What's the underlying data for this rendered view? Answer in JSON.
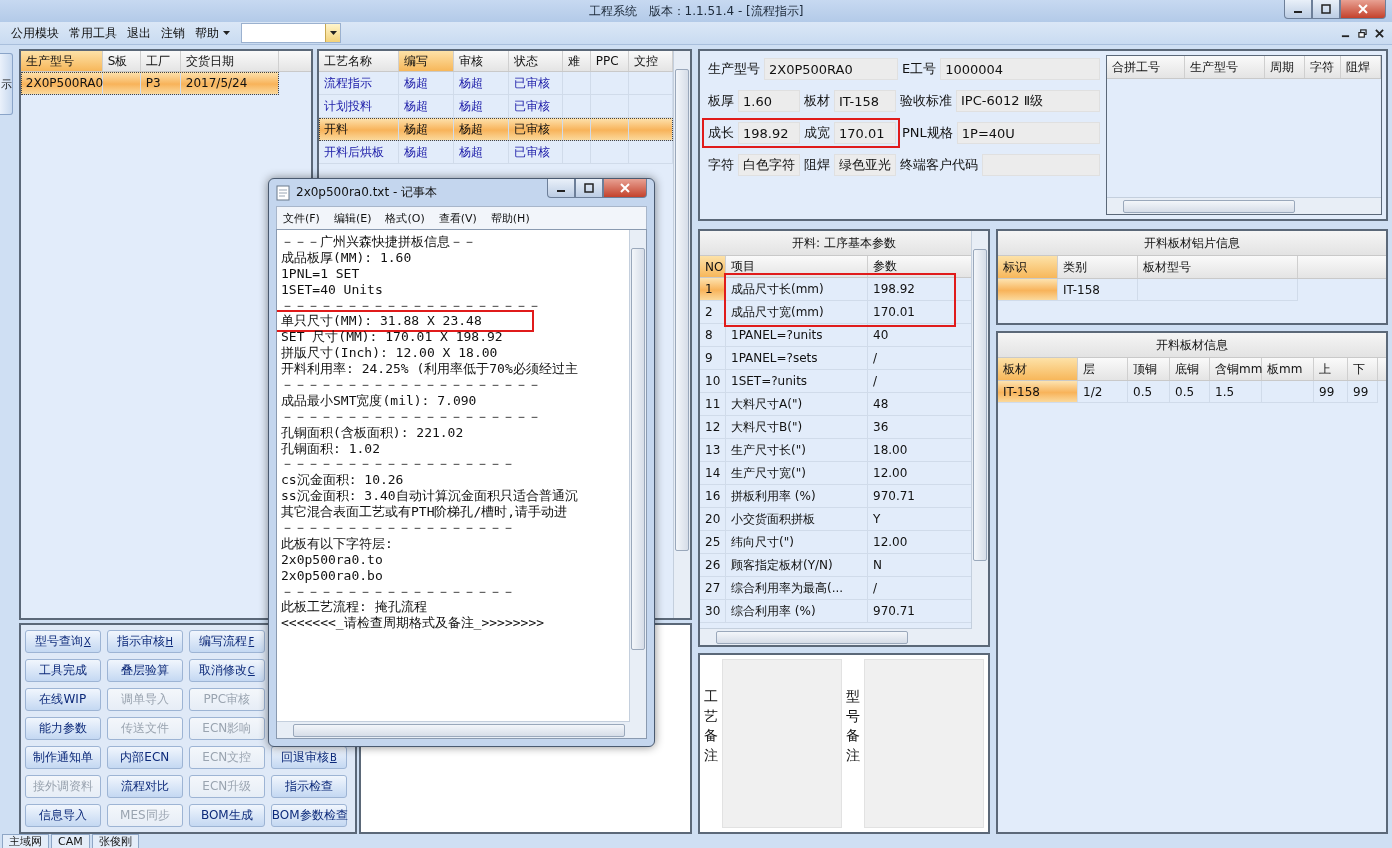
{
  "window": {
    "title": "工程系统　版本：1.1.51.4 - [流程指示]"
  },
  "menu": {
    "items": [
      {
        "label": "公用模块",
        "kind": "item"
      },
      {
        "label": "常用工具",
        "kind": "item"
      },
      {
        "label": "退出",
        "kind": "item"
      },
      {
        "label": "注销",
        "kind": "item"
      },
      {
        "label": "帮助",
        "kind": "dropdown"
      }
    ]
  },
  "edge_tab": {
    "label": "示"
  },
  "orders": {
    "columns": [
      {
        "label": "生产型号",
        "sorted": true
      },
      {
        "label": "S板",
        "sorted": false
      },
      {
        "label": "工厂",
        "sorted": false
      },
      {
        "label": "交货日期",
        "sorted": false
      }
    ],
    "rows": [
      {
        "cells": [
          "2X0P500RA0",
          "",
          "P3",
          "2017/5/24"
        ],
        "selected": true
      }
    ]
  },
  "process": {
    "columns": [
      {
        "label": "工艺名称",
        "sorted": false
      },
      {
        "label": "编写",
        "sorted": true
      },
      {
        "label": "审核",
        "sorted": false
      },
      {
        "label": "状态",
        "sorted": false
      },
      {
        "label": "难",
        "sorted": false
      },
      {
        "label": "PPC",
        "sorted": false
      },
      {
        "label": "文控",
        "sorted": false
      }
    ],
    "rows": [
      {
        "cells": [
          "流程指示",
          "杨超",
          "杨超",
          "已审核",
          "",
          "",
          ""
        ],
        "selected": false
      },
      {
        "cells": [
          "计划投料",
          "杨超",
          "杨超",
          "已审核",
          "",
          "",
          ""
        ],
        "selected": false
      },
      {
        "cells": [
          "开料",
          "杨超",
          "杨超",
          "已审核",
          "",
          "",
          ""
        ],
        "selected": true
      },
      {
        "cells": [
          "开料后烘板",
          "杨超",
          "杨超",
          "已审核",
          "",
          "",
          ""
        ],
        "selected": false
      }
    ]
  },
  "button_rows": [
    [
      {
        "label": "型号查询",
        "hotkey": "X",
        "disabled": false
      },
      {
        "label": "指示审核",
        "hotkey": "H",
        "disabled": false
      },
      {
        "label": "编写流程",
        "hotkey": "F",
        "disabled": false
      }
    ],
    [
      {
        "label": "工具完成",
        "disabled": false
      },
      {
        "label": "叠层验算",
        "disabled": false
      },
      {
        "label": "取消修改",
        "hotkey": "C",
        "disabled": false
      }
    ],
    [
      {
        "label": "在线WIP",
        "disabled": false
      },
      {
        "label": "调单导入",
        "disabled": true
      },
      {
        "label": "PPC审核",
        "disabled": true
      }
    ],
    [
      {
        "label": "能力参数",
        "disabled": false
      },
      {
        "label": "传送文件",
        "disabled": true
      },
      {
        "label": "ECN影响",
        "disabled": true
      }
    ],
    [
      {
        "label": "制作通知单",
        "disabled": false
      },
      {
        "label": "内部ECN",
        "disabled": false
      },
      {
        "label": "ECN文控",
        "disabled": true
      },
      {
        "label": "回退审核",
        "hotkey": "B",
        "disabled": false
      }
    ],
    [
      {
        "label": "接外调资料",
        "disabled": true
      },
      {
        "label": "流程对比",
        "disabled": false
      },
      {
        "label": "ECN升级",
        "disabled": true
      },
      {
        "label": "指示检查",
        "disabled": false
      }
    ],
    [
      {
        "label": "信息导入",
        "disabled": false
      },
      {
        "label": "MES同步",
        "disabled": true
      },
      {
        "label": "BOM生成",
        "disabled": false
      },
      {
        "label": "BOM参数检查",
        "disabled": false
      }
    ]
  ],
  "notepad": {
    "title": "2x0p500ra0.txt - 记事本",
    "menu": [
      "文件(F)",
      "编辑(E)",
      "格式(O)",
      "查看(V)",
      "帮助(H)"
    ],
    "lines": [
      {
        "text": "－－－广州兴森快捷拼板信息－－"
      },
      {
        "text": "成品板厚(MM): 1.60"
      },
      {
        "text": "1PNL=1 SET"
      },
      {
        "text": "1SET=40 Units"
      },
      {
        "text": "－－－－－－－－－－－－－－－－－－－－"
      },
      {
        "text": "单只尺寸(MM): 31.88 X 23.48",
        "highlighted": true
      },
      {
        "text": "SET 尺寸(MM): 170.01 X 198.92"
      },
      {
        "text": "拼版尺寸(Inch): 12.00 X 18.00"
      },
      {
        "text": "开料利用率: 24.25% (利用率低于70%必须经过主"
      },
      {
        "text": "－－－－－－－－－－－－－－－－－－－－"
      },
      {
        "text": "成品最小SMT宽度(mil): 7.090"
      },
      {
        "text": "－－－－－－－－－－－－－－－－－－－－"
      },
      {
        "text": "孔铜面积(含板面积): 221.02"
      },
      {
        "text": "孔铜面积: 1.02"
      },
      {
        "text": "－－－－－－－－－－－－－－－－－－"
      },
      {
        "text": "cs沉金面积: 10.26"
      },
      {
        "text": "ss沉金面积: 3.40自动计算沉金面积只适合普通沉"
      },
      {
        "text": "其它混合表面工艺或有PTH阶梯孔/槽时,请手动进"
      },
      {
        "text": "－－－－－－－－－－－－－－－－－－"
      },
      {
        "text": "此板有以下字符层:"
      },
      {
        "text": "2x0p500ra0.to"
      },
      {
        "text": "2x0p500ra0.bo"
      },
      {
        "text": "－－－－－－－－－－－－－－－－－－"
      },
      {
        "text": "此板工艺流程: 掩孔流程"
      },
      {
        "text": "<<<<<<<_请检查周期格式及备注_>>>>>>>>"
      }
    ]
  },
  "form": {
    "lines": [
      {
        "fields": [
          {
            "label": "生产型号",
            "value": "2X0P500RA0"
          },
          {
            "label": "E工号",
            "value": "1000004"
          }
        ]
      },
      {
        "fields": [
          {
            "label": "板厚",
            "value": "1.60"
          },
          {
            "label": "板材",
            "value": "IT-158"
          },
          {
            "label": "验收标准",
            "value": "IPC-6012 Ⅱ级"
          }
        ]
      },
      {
        "fields": [
          {
            "label": "成长",
            "value": "198.92",
            "highlighted": true
          },
          {
            "label": "成宽",
            "value": "170.01",
            "highlighted": true
          },
          {
            "label": "PNL规格",
            "value": "1P=40U"
          }
        ]
      },
      {
        "fields": [
          {
            "label": "字符",
            "value": "白色字符"
          },
          {
            "label": "阻焊",
            "value": "绿色亚光"
          },
          {
            "label": "终端客户代码"
          }
        ]
      }
    ]
  },
  "merge_table": {
    "columns": [
      {
        "label": "合拼工号",
        "sorted": false
      },
      {
        "label": "生产型号",
        "sorted": false
      },
      {
        "label": "周期",
        "sorted": false
      },
      {
        "label": "字符",
        "sorted": false
      },
      {
        "label": "阻焊",
        "sorted": false
      }
    ]
  },
  "params": {
    "title": "开料: 工序基本参数",
    "columns": [
      {
        "label": "NO",
        "sorted": true
      },
      {
        "label": "项目",
        "sorted": false
      },
      {
        "label": "参数",
        "sorted": false
      }
    ],
    "rows": [
      {
        "cells": [
          "1",
          "成品尺寸长(mm)",
          "198.92"
        ],
        "selected": true,
        "highlighted": true
      },
      {
        "cells": [
          "2",
          "成品尺寸宽(mm)",
          "170.01"
        ],
        "selected": false,
        "highlighted": true
      },
      {
        "cells": [
          "8",
          "1PANEL=?units",
          "40"
        ],
        "selected": false
      },
      {
        "cells": [
          "9",
          "1PANEL=?sets",
          "/"
        ],
        "selected": false
      },
      {
        "cells": [
          "10",
          "1SET=?units",
          "/"
        ],
        "selected": false
      },
      {
        "cells": [
          "11",
          "大料尺寸A(\")",
          "48"
        ],
        "selected": false
      },
      {
        "cells": [
          "12",
          "大料尺寸B(\")",
          "36"
        ],
        "selected": false
      },
      {
        "cells": [
          "13",
          "生产尺寸长(\")",
          "18.00"
        ],
        "selected": false
      },
      {
        "cells": [
          "14",
          "生产尺寸宽(\")",
          "12.00"
        ],
        "selected": false
      },
      {
        "cells": [
          "16",
          "拼板利用率 (%)",
          "970.71"
        ],
        "selected": false
      },
      {
        "cells": [
          "20",
          "小交货面积拼板",
          "Y"
        ],
        "selected": false
      },
      {
        "cells": [
          "25",
          "纬向尺寸(\")",
          "12.00"
        ],
        "selected": false
      },
      {
        "cells": [
          "26",
          "顾客指定板材(Y/N)",
          "N"
        ],
        "selected": false
      },
      {
        "cells": [
          "27",
          "综合利用率为最高(...",
          "/"
        ],
        "selected": false
      },
      {
        "cells": [
          "30",
          "综合利用率 (%)",
          "970.71"
        ],
        "selected": false
      }
    ]
  },
  "notes": [
    {
      "label": "工艺备注"
    },
    {
      "label": "型号备注"
    }
  ],
  "foil": {
    "title": "开料板材铝片信息",
    "columns": [
      {
        "label": "标识",
        "sorted": true
      },
      {
        "label": "类别",
        "sorted": false
      },
      {
        "label": "板材型号",
        "sorted": false
      }
    ],
    "rows": [
      {
        "cells": [
          "",
          "IT-158",
          ""
        ],
        "selected": true
      }
    ]
  },
  "boards": {
    "title": "开料板材信息",
    "columns": [
      {
        "label": "板材",
        "sorted": true
      },
      {
        "label": "层",
        "sorted": false
      },
      {
        "label": "顶铜",
        "sorted": false
      },
      {
        "label": "底铜",
        "sorted": false
      },
      {
        "label": "含铜mm",
        "sorted": false
      },
      {
        "label": "板mm",
        "sorted": false
      },
      {
        "label": "上",
        "sorted": false
      },
      {
        "label": "下",
        "sorted": false
      }
    ],
    "rows": [
      {
        "cells": [
          "IT-158",
          "1/2",
          "0.5",
          "0.5",
          "1.5",
          "",
          "99",
          "99"
        ],
        "selected": true
      }
    ]
  },
  "bottom_tabs": [
    {
      "label": "主域网"
    },
    {
      "label": "CAM"
    },
    {
      "label": "张俊刚"
    }
  ]
}
